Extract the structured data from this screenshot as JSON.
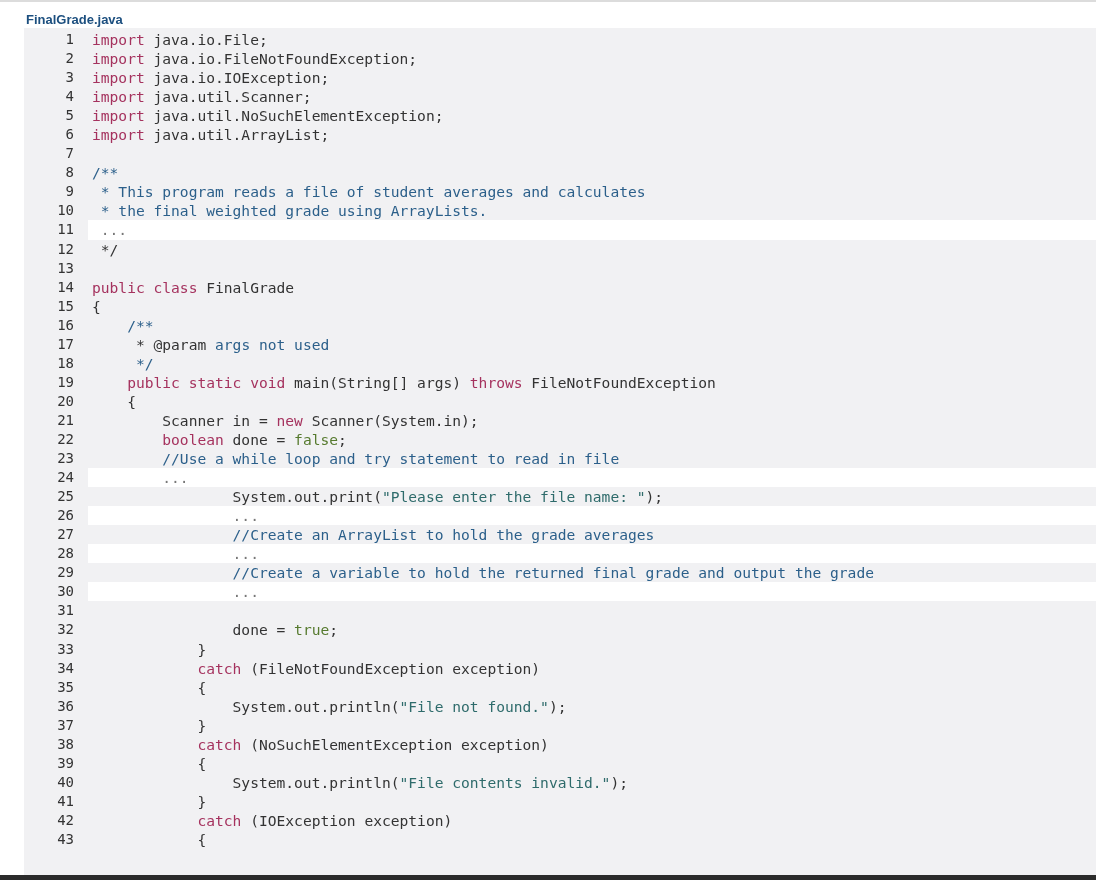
{
  "file": {
    "title": "FinalGrade.java"
  },
  "lines": [
    {
      "number": "1",
      "editable": false,
      "tokens": [
        {
          "kind": "keyword",
          "text": "import"
        },
        {
          "kind": "plain",
          "text": " java.io.File;"
        }
      ]
    },
    {
      "number": "2",
      "editable": false,
      "tokens": [
        {
          "kind": "keyword",
          "text": "import"
        },
        {
          "kind": "plain",
          "text": " java.io.FileNotFoundException;"
        }
      ]
    },
    {
      "number": "3",
      "editable": false,
      "tokens": [
        {
          "kind": "keyword",
          "text": "import"
        },
        {
          "kind": "plain",
          "text": " java.io.IOException;"
        }
      ]
    },
    {
      "number": "4",
      "editable": false,
      "tokens": [
        {
          "kind": "keyword",
          "text": "import"
        },
        {
          "kind": "plain",
          "text": " java.util.Scanner;"
        }
      ]
    },
    {
      "number": "5",
      "editable": false,
      "tokens": [
        {
          "kind": "keyword",
          "text": "import"
        },
        {
          "kind": "plain",
          "text": " java.util.NoSuchElementException;"
        }
      ]
    },
    {
      "number": "6",
      "editable": false,
      "tokens": [
        {
          "kind": "keyword",
          "text": "import"
        },
        {
          "kind": "plain",
          "text": " java.util.ArrayList;"
        }
      ]
    },
    {
      "number": "7",
      "editable": false
    },
    {
      "number": "8",
      "editable": false,
      "tokens": [
        {
          "kind": "comment",
          "text": "/**"
        }
      ]
    },
    {
      "number": "9",
      "editable": false,
      "tokens": [
        {
          "kind": "comment",
          "text": " * This program reads a file of student averages and calculates"
        }
      ]
    },
    {
      "number": "10",
      "editable": false,
      "tokens": [
        {
          "kind": "comment",
          "text": " * the final weighted grade using ArrayLists."
        }
      ]
    },
    {
      "number": "11",
      "editable": true,
      "tokens": [
        {
          "kind": "elided",
          "text": " ..."
        }
      ]
    },
    {
      "number": "12",
      "editable": false,
      "tokens": [
        {
          "kind": "plain",
          "text": " */"
        }
      ]
    },
    {
      "number": "13",
      "editable": false
    },
    {
      "number": "14",
      "editable": false,
      "tokens": [
        {
          "kind": "keyword",
          "text": "public class"
        },
        {
          "kind": "plain",
          "text": " FinalGrade"
        }
      ]
    },
    {
      "number": "15",
      "editable": false,
      "tokens": [
        {
          "kind": "plain",
          "text": "{"
        }
      ]
    },
    {
      "number": "16",
      "editable": false,
      "tokens": [
        {
          "kind": "comment",
          "text": "    /**"
        }
      ]
    },
    {
      "number": "17",
      "editable": false,
      "tokens": [
        {
          "kind": "plain",
          "text": "     * @param"
        },
        {
          "kind": "comment",
          "text": " args not used"
        }
      ]
    },
    {
      "number": "18",
      "editable": false,
      "tokens": [
        {
          "kind": "comment",
          "text": "     */"
        }
      ]
    },
    {
      "number": "19",
      "editable": false,
      "tokens": [
        {
          "kind": "keyword",
          "text": "    public static void"
        },
        {
          "kind": "plain",
          "text": " main(String[] args) "
        },
        {
          "kind": "keyword",
          "text": "throws"
        },
        {
          "kind": "plain",
          "text": " FileNotFoundException"
        }
      ]
    },
    {
      "number": "20",
      "editable": false,
      "tokens": [
        {
          "kind": "plain",
          "text": "    {"
        }
      ]
    },
    {
      "number": "21",
      "editable": false,
      "tokens": [
        {
          "kind": "plain",
          "text": "        Scanner in = "
        },
        {
          "kind": "keyword",
          "text": "new"
        },
        {
          "kind": "plain",
          "text": " Scanner(System.in);"
        }
      ]
    },
    {
      "number": "22",
      "editable": false,
      "tokens": [
        {
          "kind": "keyword",
          "text": "        boolean"
        },
        {
          "kind": "plain",
          "text": " done = "
        },
        {
          "kind": "literal",
          "text": "false"
        },
        {
          "kind": "plain",
          "text": ";"
        }
      ]
    },
    {
      "number": "23",
      "editable": false,
      "tokens": [
        {
          "kind": "comment",
          "text": "        //Use a while loop and try statement to read in file"
        }
      ]
    },
    {
      "number": "24",
      "editable": true,
      "tokens": [
        {
          "kind": "elided",
          "text": "        ..."
        }
      ]
    },
    {
      "number": "25",
      "editable": false,
      "tokens": [
        {
          "kind": "plain",
          "text": "                System.out.print("
        },
        {
          "kind": "string",
          "text": "\"Please enter the file name: \""
        },
        {
          "kind": "plain",
          "text": ");"
        }
      ]
    },
    {
      "number": "26",
      "editable": true,
      "tokens": [
        {
          "kind": "elided",
          "text": "                ..."
        }
      ]
    },
    {
      "number": "27",
      "editable": false,
      "tokens": [
        {
          "kind": "comment",
          "text": "                //Create an ArrayList to hold the grade averages"
        }
      ]
    },
    {
      "number": "28",
      "editable": true,
      "tokens": [
        {
          "kind": "elided",
          "text": "                ..."
        }
      ]
    },
    {
      "number": "29",
      "editable": false,
      "tokens": [
        {
          "kind": "comment",
          "text": "                //Create a variable to hold the returned final grade and output the grade"
        }
      ]
    },
    {
      "number": "30",
      "editable": true,
      "tokens": [
        {
          "kind": "elided",
          "text": "                ..."
        }
      ]
    },
    {
      "number": "31",
      "editable": false
    },
    {
      "number": "32",
      "editable": false,
      "tokens": [
        {
          "kind": "plain",
          "text": "                done = "
        },
        {
          "kind": "literal",
          "text": "true"
        },
        {
          "kind": "plain",
          "text": ";"
        }
      ]
    },
    {
      "number": "33",
      "editable": false,
      "tokens": [
        {
          "kind": "plain",
          "text": "            }"
        }
      ]
    },
    {
      "number": "34",
      "editable": false,
      "tokens": [
        {
          "kind": "keyword",
          "text": "            catch"
        },
        {
          "kind": "plain",
          "text": " (FileNotFoundException exception)"
        }
      ]
    },
    {
      "number": "35",
      "editable": false,
      "tokens": [
        {
          "kind": "plain",
          "text": "            {"
        }
      ]
    },
    {
      "number": "36",
      "editable": false,
      "tokens": [
        {
          "kind": "plain",
          "text": "                System.out.println("
        },
        {
          "kind": "string",
          "text": "\"File not found.\""
        },
        {
          "kind": "plain",
          "text": ");"
        }
      ]
    },
    {
      "number": "37",
      "editable": false,
      "tokens": [
        {
          "kind": "plain",
          "text": "            }"
        }
      ]
    },
    {
      "number": "38",
      "editable": false,
      "tokens": [
        {
          "kind": "keyword",
          "text": "            catch"
        },
        {
          "kind": "plain",
          "text": " (NoSuchElementException exception)"
        }
      ]
    },
    {
      "number": "39",
      "editable": false,
      "tokens": [
        {
          "kind": "plain",
          "text": "            {"
        }
      ]
    },
    {
      "number": "40",
      "editable": false,
      "tokens": [
        {
          "kind": "plain",
          "text": "                System.out.println("
        },
        {
          "kind": "string",
          "text": "\"File contents invalid.\""
        },
        {
          "kind": "plain",
          "text": ");"
        }
      ]
    },
    {
      "number": "41",
      "editable": false,
      "tokens": [
        {
          "kind": "plain",
          "text": "            }"
        }
      ]
    },
    {
      "number": "42",
      "editable": false,
      "tokens": [
        {
          "kind": "keyword",
          "text": "            catch"
        },
        {
          "kind": "plain",
          "text": " (IOException exception)"
        }
      ]
    },
    {
      "number": "43",
      "editable": false,
      "tokens": [
        {
          "kind": "plain",
          "text": "            {"
        }
      ]
    }
  ]
}
